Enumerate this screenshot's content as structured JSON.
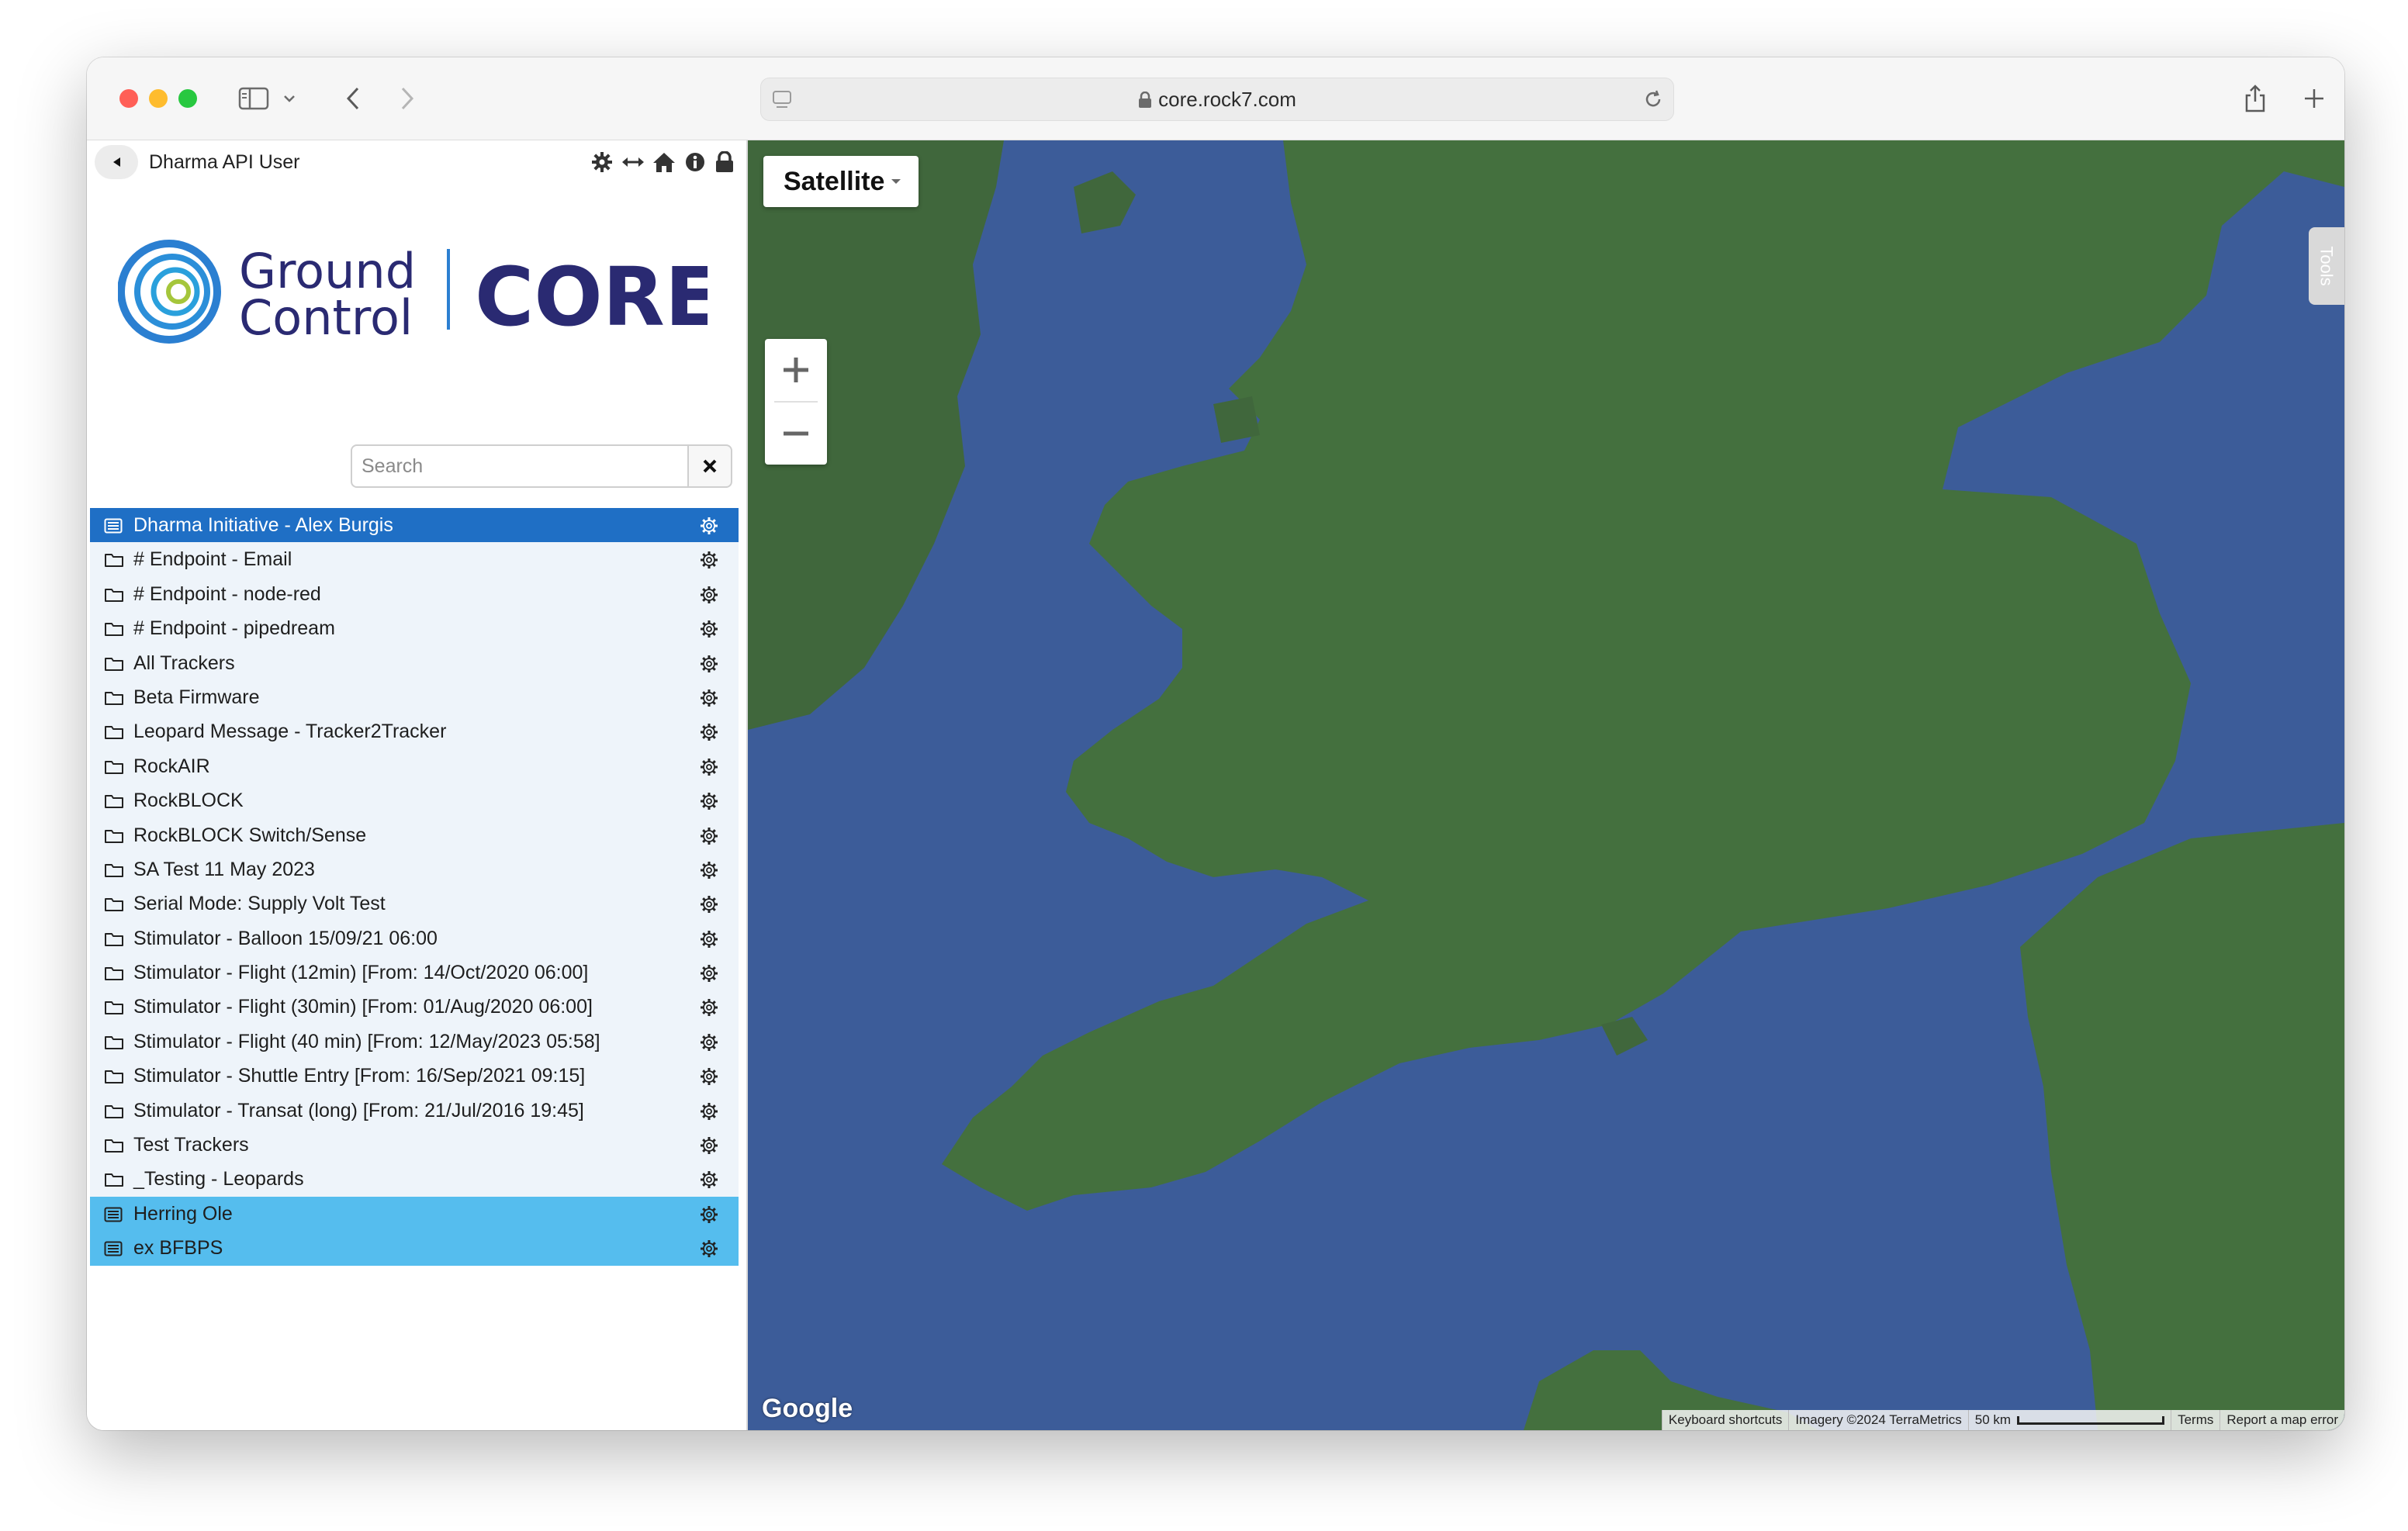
{
  "browser": {
    "url": "core.rock7.com"
  },
  "header": {
    "user_name": "Dharma API User"
  },
  "brand": {
    "ground": "Ground",
    "control": "Control",
    "product": "CORE",
    "colors": {
      "dark_blue": "#2a2a72",
      "ring_blue": "#2b7fd1",
      "ring_green": "#a5c63b"
    }
  },
  "search": {
    "placeholder": "Search",
    "value": ""
  },
  "tree": {
    "items": [
      {
        "label": "Dharma Initiative - Alex Burgis",
        "icon": "list-icon",
        "state": "active"
      },
      {
        "label": "# Endpoint - Email",
        "icon": "folder-icon",
        "state": "normal"
      },
      {
        "label": "# Endpoint - node-red",
        "icon": "folder-icon",
        "state": "normal"
      },
      {
        "label": "# Endpoint - pipedream",
        "icon": "folder-icon",
        "state": "normal"
      },
      {
        "label": "All Trackers",
        "icon": "folder-icon",
        "state": "normal"
      },
      {
        "label": "Beta Firmware",
        "icon": "folder-icon",
        "state": "normal"
      },
      {
        "label": "Leopard Message - Tracker2Tracker",
        "icon": "folder-icon",
        "state": "normal"
      },
      {
        "label": "RockAIR",
        "icon": "folder-icon",
        "state": "normal"
      },
      {
        "label": "RockBLOCK",
        "icon": "folder-icon",
        "state": "normal"
      },
      {
        "label": "RockBLOCK Switch/Sense",
        "icon": "folder-icon",
        "state": "normal"
      },
      {
        "label": "SA Test 11 May 2023",
        "icon": "folder-icon",
        "state": "normal"
      },
      {
        "label": "Serial Mode: Supply Volt Test",
        "icon": "folder-icon",
        "state": "normal"
      },
      {
        "label": "Stimulator - Balloon 15/09/21 06:00",
        "icon": "folder-icon",
        "state": "normal"
      },
      {
        "label": "Stimulator - Flight (12min) [From: 14/Oct/2020 06:00]",
        "icon": "folder-icon",
        "state": "normal"
      },
      {
        "label": "Stimulator - Flight (30min) [From: 01/Aug/2020 06:00]",
        "icon": "folder-icon",
        "state": "normal"
      },
      {
        "label": "Stimulator - Flight (40 min) [From: 12/May/2023 05:58]",
        "icon": "folder-icon",
        "state": "normal"
      },
      {
        "label": "Stimulator - Shuttle Entry [From: 16/Sep/2021 09:15]",
        "icon": "folder-icon",
        "state": "normal"
      },
      {
        "label": "Stimulator - Transat (long) [From: 21/Jul/2016 19:45]",
        "icon": "folder-icon",
        "state": "normal"
      },
      {
        "label": "Test Trackers",
        "icon": "folder-icon",
        "state": "normal"
      },
      {
        "label": "_Testing - Leopards",
        "icon": "folder-icon",
        "state": "normal"
      },
      {
        "label": "Herring Ole",
        "icon": "list-icon",
        "state": "highlighted"
      },
      {
        "label": "ex BFBPS",
        "icon": "list-icon",
        "state": "highlighted"
      }
    ]
  },
  "map": {
    "type_label": "Satellite",
    "tools_label": "Tools",
    "google_label": "Google",
    "attribution": {
      "shortcuts": "Keyboard shortcuts",
      "imagery": "Imagery ©2024 TerraMetrics",
      "scale": "50 km",
      "terms": "Terms",
      "report": "Report a map error"
    },
    "colors": {
      "sea": "#3c5c99",
      "land": "#3f6a3b"
    }
  }
}
